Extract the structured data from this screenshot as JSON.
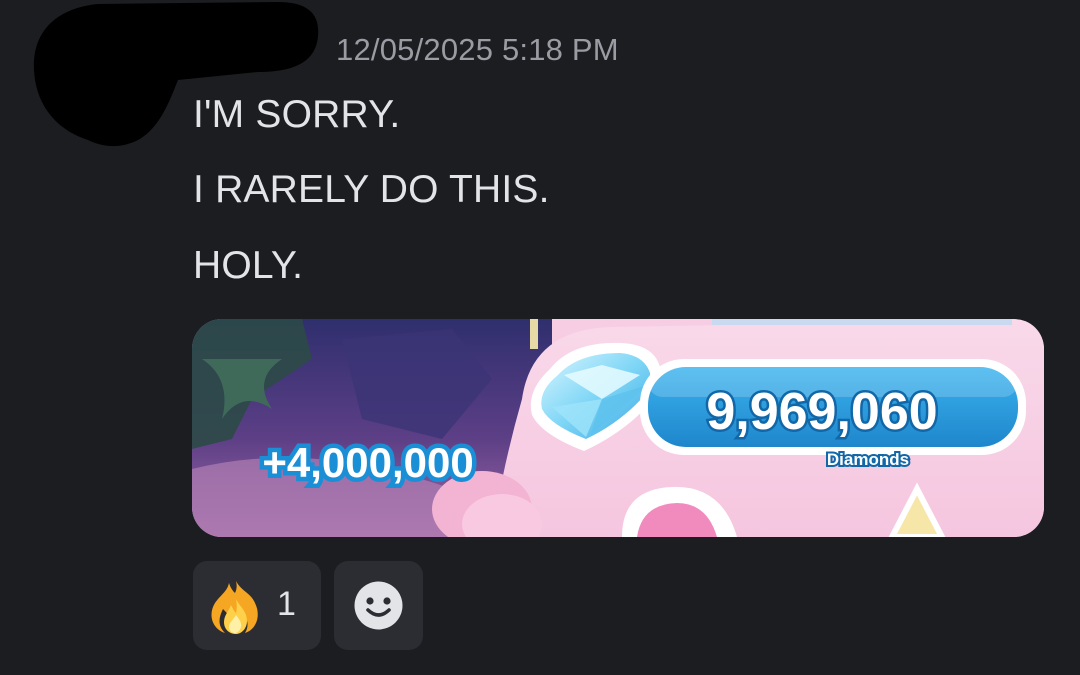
{
  "message": {
    "timestamp": "12/05/2025 5:18 PM",
    "lines": [
      "I'M SORRY.",
      "I RARELY DO THIS.",
      "HOLY."
    ]
  },
  "attachment": {
    "gain_text": "+4,000,000",
    "total_text": "9,969,060",
    "currency_label": "Diamonds",
    "icon": "diamond-icon"
  },
  "reactions": [
    {
      "emoji": "fire-icon",
      "count": "1"
    }
  ],
  "add_reaction": {
    "icon": "smiley-icon"
  },
  "colors": {
    "background": "#1c1d21",
    "text": "#e3e4e7",
    "timestamp": "#9a9ba3",
    "reaction_bg": "#2c2d33",
    "counter_blue": "#2a98d8",
    "panel_pink": "#f7cde3"
  }
}
